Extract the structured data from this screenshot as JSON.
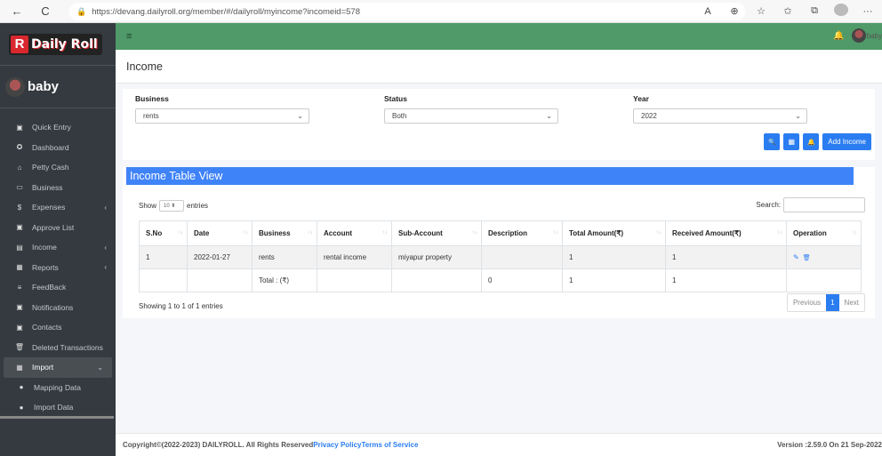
{
  "browser": {
    "url": "https://devang.dailyroll.org/member/#/dailyroll/myincome?incomeid=578",
    "back_icon": "←",
    "refresh_icon": "C",
    "lock_icon": "🔒",
    "read_aloud_icon": "A",
    "zoom_icon": "⊕",
    "favorite_icon": "☆",
    "favorites_icon": "✩",
    "collections_icon": "⧉",
    "more_icon": "···"
  },
  "brand": {
    "logo_letter": "R",
    "name": "Daily Roll"
  },
  "user": {
    "name": "baby"
  },
  "sidebar": {
    "items": [
      {
        "label": "Quick Entry",
        "icon": "▣",
        "icon_name": "quick-entry-icon",
        "chevron": ""
      },
      {
        "label": "Dashboard",
        "icon": "✪",
        "icon_name": "dashboard-icon",
        "chevron": ""
      },
      {
        "label": "Petty Cash",
        "icon": "⌂",
        "icon_name": "petty-cash-icon",
        "chevron": ""
      },
      {
        "label": "Business",
        "icon": "▭",
        "icon_name": "business-icon",
        "chevron": ""
      },
      {
        "label": "Expenses",
        "icon": "$",
        "icon_name": "expenses-icon",
        "chevron": "‹"
      },
      {
        "label": "Approve List",
        "icon": "▣",
        "icon_name": "approve-list-icon",
        "chevron": ""
      },
      {
        "label": "Income",
        "icon": "▤",
        "icon_name": "income-icon",
        "chevron": "‹"
      },
      {
        "label": "Reports",
        "icon": "▦",
        "icon_name": "reports-icon",
        "chevron": "‹"
      },
      {
        "label": "FeedBack",
        "icon": "≡",
        "icon_name": "feedback-icon",
        "chevron": ""
      },
      {
        "label": "Notifications",
        "icon": "▣",
        "icon_name": "notifications-icon",
        "chevron": ""
      },
      {
        "label": "Contacts",
        "icon": "▣",
        "icon_name": "contacts-icon",
        "chevron": ""
      },
      {
        "label": "Deleted Transactions",
        "icon": "🗑",
        "icon_name": "trash-icon",
        "chevron": ""
      },
      {
        "label": "Import",
        "icon": "▦",
        "icon_name": "import-icon",
        "chevron": "⌄"
      },
      {
        "label": "Mapping Data",
        "icon": "●",
        "icon_name": "circle-icon",
        "chevron": ""
      },
      {
        "label": "Import Data",
        "icon": "●",
        "icon_name": "circle-icon",
        "chevron": ""
      }
    ]
  },
  "topnav": {
    "menu_icon": "≡",
    "bell_icon": "🔔",
    "user_label": "baby"
  },
  "page": {
    "title": "Income"
  },
  "filters": {
    "business": {
      "label": "Business",
      "value": "rents"
    },
    "status": {
      "label": "Status",
      "value": "Both"
    },
    "year": {
      "label": "Year",
      "value": "2022"
    },
    "caret": "⌄",
    "search_icon": "🔍",
    "grid_icon": "▦",
    "bell_icon": "🔔",
    "add_label": "Add Income"
  },
  "table_view": {
    "title": "Income Table View",
    "show_label": "Show",
    "entries_value": "10 ⬍",
    "entries_label": "entries",
    "search_label": "Search:",
    "columns": [
      "S.No",
      "Date",
      "Business",
      "Account",
      "Sub-Account",
      "Description",
      "Total Amount(₹)",
      "Received Amount(₹)",
      "Operation"
    ],
    "sort_icon": "↑↓",
    "rows": [
      [
        "1",
        "2022-01-27",
        "rents",
        "rental income",
        "miyapur property",
        "",
        "1",
        "1"
      ]
    ],
    "edit_icon": "✎",
    "delete_icon": "🗑",
    "total_row": [
      "",
      "",
      "Total : (₹)",
      "",
      "",
      "0",
      "1",
      "1",
      ""
    ],
    "info": "Showing 1 to 1 of 1 entries",
    "pager": {
      "previous": "Previous",
      "current": "1",
      "next": "Next"
    }
  },
  "footer": {
    "copyright": "Copyright©(2022-2023) DAILYROLL. All Rights Reserved ",
    "privacy": "Privacy Policy",
    "terms": "Terms of Service",
    "version": "Version :2.59.0 On 21 Sep-2022"
  }
}
